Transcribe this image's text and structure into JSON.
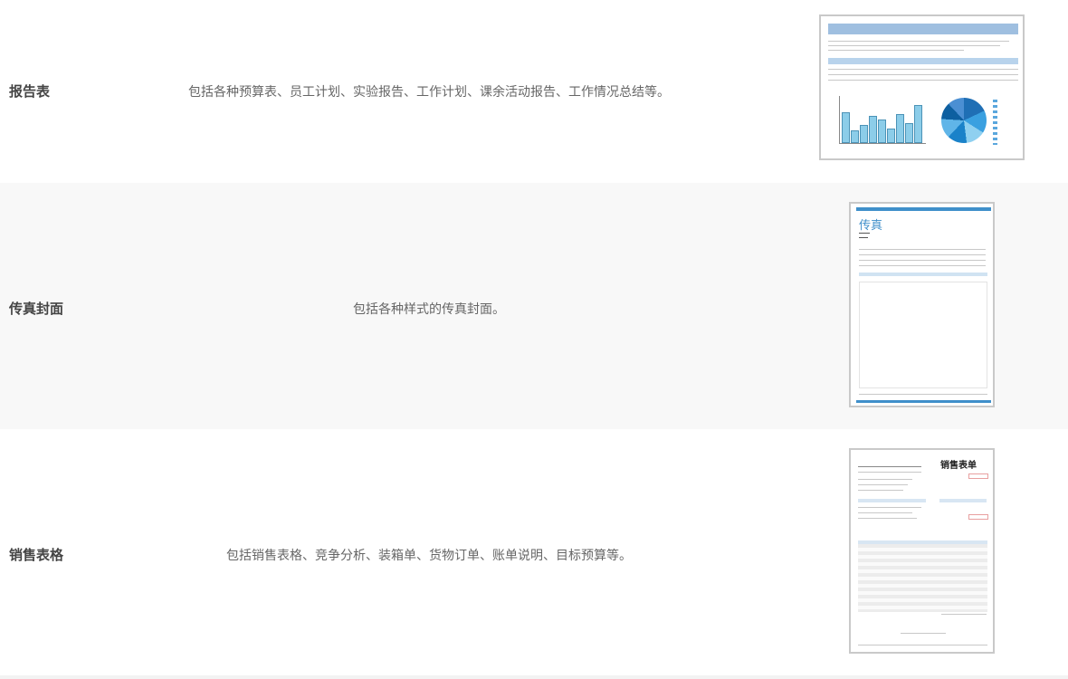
{
  "rows": [
    {
      "category": "报告表",
      "description": "包括各种预算表、员工计划、实验报告、工作计划、课余活动报告、工作情况总结等。"
    },
    {
      "category": "传真封面",
      "description": "包括各种样式的传真封面。"
    },
    {
      "category": "销售表格",
      "description": "包括销售表格、竞争分析、装箱单、货物订单、账单说明、目标预算等。"
    }
  ],
  "thumbnails": {
    "fax": {
      "title": "传真"
    },
    "sales": {
      "title": "销售表单"
    }
  },
  "colors": {
    "alt_row_bg": "#f8f8f8",
    "accent_blue": "#3f8fca",
    "border": "#c9c9c9"
  }
}
